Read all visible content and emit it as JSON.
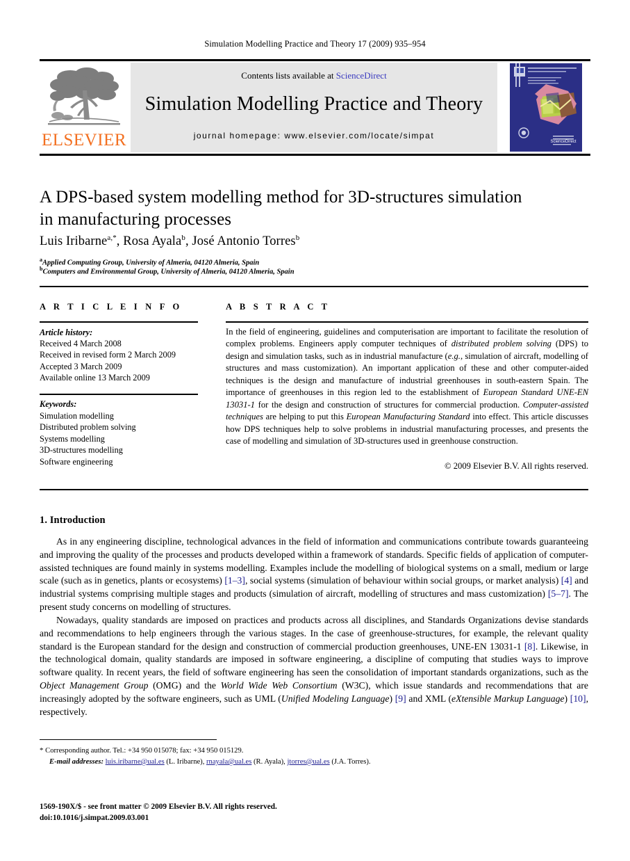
{
  "running_head": "Simulation Modelling Practice and Theory 17 (2009) 935–954",
  "banner": {
    "publisher": "ELSEVIER",
    "contents_prefix": "Contents lists available at ",
    "contents_link": "ScienceDirect",
    "journal_title": "Simulation Modelling Practice and Theory",
    "homepage": "journal homepage: www.elsevier.com/locate/simpat"
  },
  "article": {
    "title_line1": "A DPS-based system modelling method for 3D-structures simulation",
    "title_line2": "in manufacturing processes",
    "authors": "Luis Iribarne, Rosa Ayala, José Antonio Torres",
    "author_marks": {
      "first": "a,*",
      "second": "b",
      "third": "b"
    },
    "affiliation_a": "Applied Computing Group, University of Almeria, 04120 Almeria, Spain",
    "affiliation_b": "Computers and Environmental Group, University of Almeria, 04120 Almeria, Spain"
  },
  "info": {
    "heading": "A R T I C L E   I N F O",
    "history_label": "Article history:",
    "history": [
      "Received 4 March 2008",
      "Received in revised form 2 March 2009",
      "Accepted 3 March 2009",
      "Available online 13 March 2009"
    ],
    "keywords_label": "Keywords:",
    "keywords": [
      "Simulation modelling",
      "Distributed problem solving",
      "Systems modelling",
      "3D-structures modelling",
      "Software engineering"
    ]
  },
  "abstract": {
    "heading": "A B S T R A C T",
    "text_parts": [
      {
        "t": "In the field of engineering, guidelines and computerisation are important to facilitate the resolution of complex problems. Engineers apply computer techniques of ",
        "i": false
      },
      {
        "t": "distributed problem solving",
        "i": true
      },
      {
        "t": " (DPS) to design and simulation tasks, such as in industrial manufacture (",
        "i": false
      },
      {
        "t": "e.g.",
        "i": true
      },
      {
        "t": ", simulation of aircraft, modelling of structures and mass customization). An important application of these and other computer-aided techniques is the design and manufacture of industrial greenhouses in south-eastern Spain. The importance of greenhouses in this region led to the establishment of ",
        "i": false
      },
      {
        "t": "European Standard UNE-EN 13031-1",
        "i": true
      },
      {
        "t": " for the design and construction of structures for commercial production. ",
        "i": false
      },
      {
        "t": "Computer-assisted techniques",
        "i": true
      },
      {
        "t": " are helping to put this ",
        "i": false
      },
      {
        "t": "European Manufacturing Standard",
        "i": true
      },
      {
        "t": " into effect. This article discusses how DPS techniques help to solve problems in industrial manufacturing processes, and presents the case of modelling and simulation of 3D-structures used in greenhouse construction.",
        "i": false
      }
    ],
    "copyright": "© 2009 Elsevier B.V. All rights reserved."
  },
  "section": {
    "heading": "1. Introduction",
    "paragraph1": [
      {
        "t": "As in any engineering discipline, technological advances in the field of information and communications contribute towards guaranteeing and improving the quality of the processes and products developed within a framework of standards. Specific fields of application of computer-assisted techniques are found mainly in systems modelling. Examples include the modelling of biological systems on a small, medium or large scale (such as in genetics, plants or ecosystems) ",
        "k": "plain"
      },
      {
        "t": "[1–3]",
        "k": "ref"
      },
      {
        "t": ", social systems (simulation of behaviour within social groups, or market analysis) ",
        "k": "plain"
      },
      {
        "t": "[4]",
        "k": "ref"
      },
      {
        "t": " and industrial systems comprising multiple stages and products (simulation of aircraft, modelling of structures and mass customization) ",
        "k": "plain"
      },
      {
        "t": "[5–7]",
        "k": "ref"
      },
      {
        "t": ". The present study concerns on modelling of structures.",
        "k": "plain"
      }
    ],
    "paragraph2": [
      {
        "t": "Nowadays, quality standards are imposed on practices and products across all disciplines, and Standards Organizations devise standards and recommendations to help engineers through the various stages. In the case of greenhouse-structures, for example, the relevant quality standard is the European standard for the design and construction of commercial production greenhouses, UNE-EN 13031-1 ",
        "k": "plain"
      },
      {
        "t": "[8]",
        "k": "ref"
      },
      {
        "t": ". Likewise, in the technological domain, quality standards are imposed in software engineering, a discipline of computing that studies ways to improve software quality. In recent years, the field of software engineering has seen the consolidation of important standards organizations, such as the ",
        "k": "plain"
      },
      {
        "t": "Object Management Group",
        "k": "italic"
      },
      {
        "t": " (OMG) and the ",
        "k": "plain"
      },
      {
        "t": "World Wide Web Consortium",
        "k": "italic"
      },
      {
        "t": " (W3C), which issue standards and recommendations that are increasingly adopted by the software engineers, such as UML (",
        "k": "plain"
      },
      {
        "t": "Unified Modeling Language",
        "k": "italic"
      },
      {
        "t": ") ",
        "k": "plain"
      },
      {
        "t": "[9]",
        "k": "ref"
      },
      {
        "t": " and XML (",
        "k": "plain"
      },
      {
        "t": "eXtensible Markup Language",
        "k": "italic"
      },
      {
        "t": ") ",
        "k": "plain"
      },
      {
        "t": "[10]",
        "k": "ref"
      },
      {
        "t": ", respectively.",
        "k": "plain"
      }
    ]
  },
  "footnote": {
    "corresponding": "Corresponding author. Tel.: +34 950 015078; fax: +34 950 015129.",
    "email_label": "E-mail addresses:",
    "emails": [
      {
        "address": "luis.iribarne@ual.es",
        "person": "(L. Iribarne)"
      },
      {
        "address": "rnayala@ual.es",
        "person": "(R. Ayala)"
      },
      {
        "address": "jtorres@ual.es",
        "person": "(J.A. Torres)"
      }
    ],
    "issn_line": "1569-190X/$ - see front matter © 2009 Elsevier B.V. All rights reserved.",
    "doi_line": "doi:10.1016/j.simpat.2009.03.001"
  },
  "colors": {
    "link": "#3b3bbf",
    "reference": "#1c1c8f",
    "elsevier_orange": "#F37021",
    "banner_grey": "#e6e6e6",
    "cover_blue": "#2b2f86"
  }
}
